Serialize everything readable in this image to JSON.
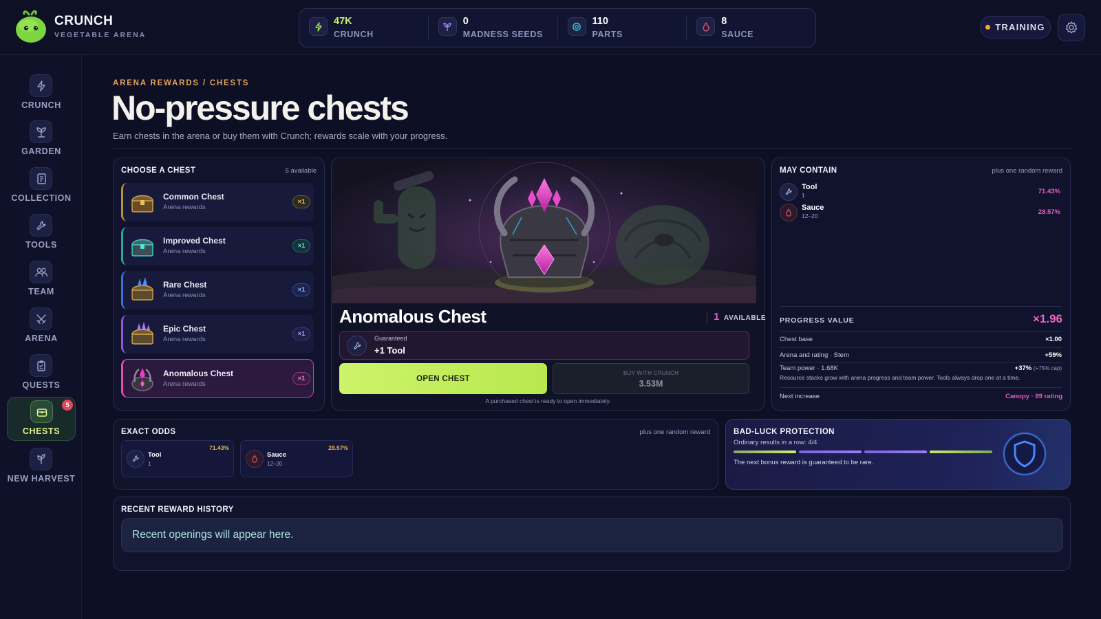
{
  "app": {
    "title": "CRUNCH",
    "subtitle": "VEGETABLE ARENA",
    "logo_icon": "green-sprout-blob-logo"
  },
  "resources": [
    {
      "value": "47K",
      "label": "CRUNCH",
      "icon": "lightning-icon",
      "color": "#9fe05a"
    },
    {
      "value": "0",
      "label": "MADNESS SEEDS",
      "icon": "sprout-icon",
      "color": "#a98cf5"
    },
    {
      "value": "110",
      "label": "PARTS",
      "icon": "gear-target-icon",
      "color": "#3fd3df"
    },
    {
      "value": "8",
      "label": "SAUCE",
      "icon": "drop-icon",
      "color": "#f0585f"
    }
  ],
  "header_actions": {
    "training_label": "TRAINING",
    "settings_icon": "gear-icon"
  },
  "sidebar": {
    "items": [
      {
        "label": "CRUNCH",
        "icon": "lightning-icon"
      },
      {
        "label": "GARDEN",
        "icon": "sprout-icon"
      },
      {
        "label": "COLLECTION",
        "icon": "book-icon"
      },
      {
        "label": "TOOLS",
        "icon": "wrench-icon"
      },
      {
        "label": "TEAM",
        "icon": "team-icon"
      },
      {
        "label": "ARENA",
        "icon": "crossed-swords-icon"
      },
      {
        "label": "QUESTS",
        "icon": "clipboard-icon"
      },
      {
        "label": "CHESTS",
        "icon": "chest-icon",
        "active": true,
        "badge": "5"
      },
      {
        "label": "NEW HARVEST",
        "icon": "plant-icon"
      }
    ]
  },
  "page": {
    "breadcrumb": "ARENA REWARDS / CHESTS",
    "title": "No-pressure chests",
    "subtitle": "Earn chests in the arena or buy them with Crunch; rewards scale with your progress."
  },
  "chest_list": {
    "title": "CHOOSE A CHEST",
    "note": "5 available",
    "items": [
      {
        "name": "Common Chest",
        "sub": "Arena rewards",
        "count": "×1",
        "accent": "#c9a24a"
      },
      {
        "name": "Improved Chest",
        "sub": "Arena rewards",
        "count": "×1",
        "accent": "#3cc9c4"
      },
      {
        "name": "Rare Chest",
        "sub": "Arena rewards",
        "count": "×1",
        "accent": "#5a8ef0"
      },
      {
        "name": "Epic Chest",
        "sub": "Arena rewards",
        "count": "×1",
        "accent": "#a36cf0"
      },
      {
        "name": "Anomalous Chest",
        "sub": "Arena rewards",
        "count": "×1",
        "accent": "#e04db3",
        "selected": true
      }
    ]
  },
  "hero": {
    "name": "Anomalous Chest",
    "available_count": "1",
    "available_label": "AVAILABLE",
    "guaranteed_label": "Guaranteed",
    "guaranteed_value": "+1 Tool",
    "guaranteed_icon": "tool-icon",
    "open_label": "OPEN CHEST",
    "buy_label": "BUY WITH CRUNCH",
    "buy_price": "3.53M",
    "note": "A purchased chest is ready to open immediately."
  },
  "may_contain": {
    "title": "MAY CONTAIN",
    "note": "plus one random reward",
    "items": [
      {
        "name": "Tool",
        "qty": "1",
        "pct": "71.43%",
        "icon": "tool-icon"
      },
      {
        "name": "Sauce",
        "qty": "12–20",
        "pct": "28.57%",
        "icon": "drop-icon"
      }
    ]
  },
  "progress": {
    "title": "PROGRESS VALUE",
    "multiplier": "×1.96",
    "rows": [
      {
        "key": "Chest base",
        "value": "×1.00",
        "extra": ""
      },
      {
        "key": "Arena and rating · Stem",
        "value": "+59%",
        "extra": ""
      },
      {
        "key": "Team power · 1.68K",
        "value": "+37%",
        "extra": "(+75% cap)"
      }
    ],
    "note": "Resource stacks grow with arena progress and team power. Tools always drop one at a time.",
    "next_label": "Next increase",
    "next_value": "Canopy · 89 rating"
  },
  "exact_odds": {
    "title": "EXACT ODDS",
    "note": "plus one random reward",
    "items": [
      {
        "name": "Tool",
        "qty": "1",
        "pct": "71.43%",
        "icon": "tool-icon"
      },
      {
        "name": "Sauce",
        "qty": "12–20",
        "pct": "28.57%",
        "icon": "drop-icon"
      }
    ]
  },
  "bad_luck": {
    "title": "BAD-LUCK PROTECTION",
    "subtitle": "Ordinary results in a row: 4/4",
    "progress": 4,
    "total": 4,
    "note": "The next bonus reward is guaranteed to be rare.",
    "icon": "shield-icon"
  },
  "history": {
    "title": "RECENT REWARD HISTORY",
    "empty": "Recent openings will appear here."
  }
}
